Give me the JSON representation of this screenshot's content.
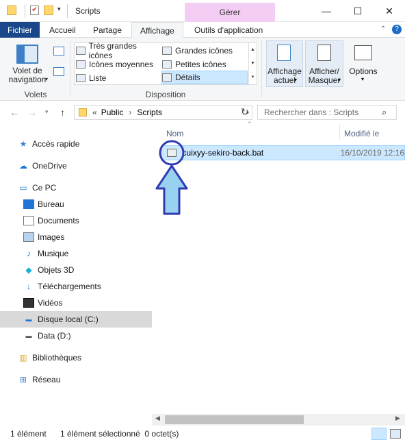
{
  "window": {
    "title": "Scripts",
    "contextual_tab_header": "Gérer",
    "controls": {
      "minimize": "—",
      "maximize": "☐",
      "close": "✕"
    }
  },
  "ribbon_tabs": [
    {
      "label": "Fichier"
    },
    {
      "label": "Accueil"
    },
    {
      "label": "Partage"
    },
    {
      "label": "Affichage"
    },
    {
      "label": "Outils d'application"
    }
  ],
  "ribbon": {
    "panes": {
      "navigation_pane_label": "Volet de\nnavigation",
      "group_label": "Volets"
    },
    "layout": {
      "group_label": "Disposition",
      "items": [
        {
          "label": "Très grandes icônes"
        },
        {
          "label": "Grandes icônes"
        },
        {
          "label": "Icônes moyennes"
        },
        {
          "label": "Petites icônes"
        },
        {
          "label": "Liste"
        },
        {
          "label": "Détails"
        }
      ]
    },
    "current_view": {
      "label": "Affichage\nactuel"
    },
    "show_hide": {
      "label": "Afficher/\nMasquer"
    },
    "options": {
      "label": "Options"
    }
  },
  "address": {
    "overflow": "«",
    "crumbs": [
      "Public",
      "Scripts"
    ],
    "search_placeholder": "Rechercher dans : Scripts"
  },
  "sidebar": {
    "items": [
      {
        "label": "Accès rapide",
        "icon": "star-icon"
      },
      {
        "label": "OneDrive",
        "icon": "cloud-icon"
      },
      {
        "label": "Ce PC",
        "icon": "computer-icon"
      },
      {
        "label": "Bureau",
        "icon": "desktop-icon"
      },
      {
        "label": "Documents",
        "icon": "documents-icon"
      },
      {
        "label": "Images",
        "icon": "images-icon"
      },
      {
        "label": "Musique",
        "icon": "music-icon"
      },
      {
        "label": "Objets 3D",
        "icon": "cube-icon"
      },
      {
        "label": "Téléchargements",
        "icon": "download-icon"
      },
      {
        "label": "Vidéos",
        "icon": "video-icon"
      },
      {
        "label": "Disque local (C:)",
        "icon": "drive-icon"
      },
      {
        "label": "Data (D:)",
        "icon": "drive-icon"
      },
      {
        "label": "Bibliothèques",
        "icon": "library-icon"
      },
      {
        "label": "Réseau",
        "icon": "network-icon"
      }
    ]
  },
  "file_list": {
    "columns": {
      "name": "Nom",
      "modified": "Modifié le"
    },
    "rows": [
      {
        "name": "cuixyy-sekiro-back.bat",
        "modified": "16/10/2019 12:16"
      }
    ]
  },
  "status": {
    "count": "1 élément",
    "selection": "1 élément sélectionné  0 octet(s)"
  },
  "colors": {
    "accent": "#19478a",
    "selection": "#cce8ff",
    "manage_tab": "#f4cdf4",
    "annotation": "#2f3bb0",
    "annotation_fill": "#99d1f0"
  }
}
